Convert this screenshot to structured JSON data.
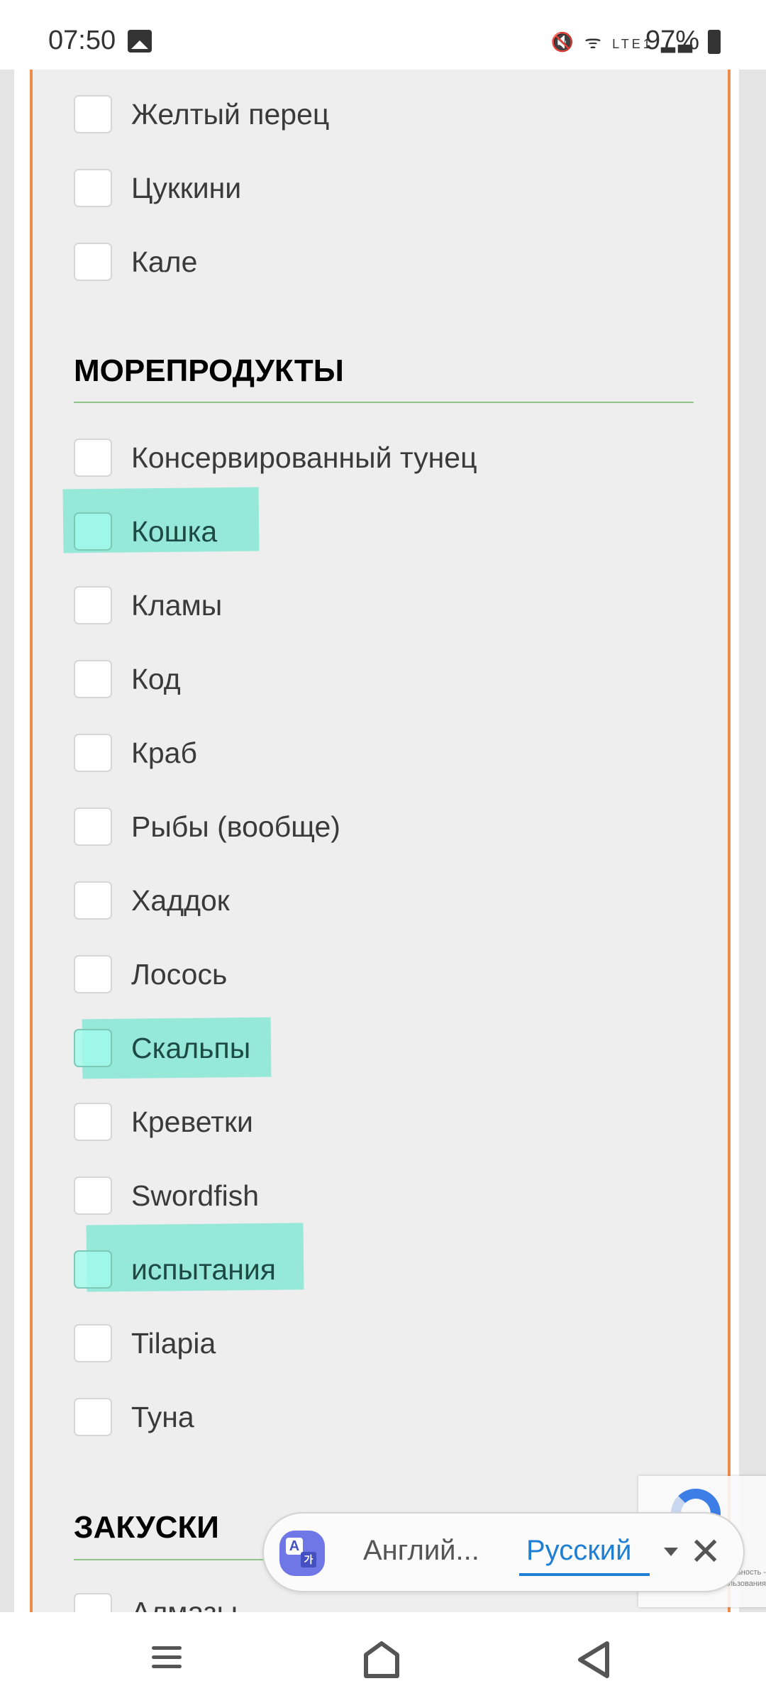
{
  "status_bar": {
    "time": "07:50",
    "battery": "97%",
    "network": "LTE1",
    "icons": [
      "gallery-icon",
      "mute-icon",
      "wifi-icon",
      "volte-icon",
      "signal-icon",
      "battery-icon"
    ]
  },
  "list": {
    "top_items": [
      "Желтый перец",
      "Цуккини",
      "Кале"
    ],
    "seafood_heading": "МОРЕПРОДУКТЫ",
    "seafood_items": [
      "Консервированный тунец",
      "Кошка",
      "Кламы",
      "Код",
      "Краб",
      "Рыбы (вообще)",
      "Хаддок",
      "Лосось",
      "Скальпы",
      "Креветки",
      "Swordfish",
      "испытания",
      "Tilapia",
      "Туна"
    ],
    "highlighted": [
      "Кошка",
      "Скальпы",
      "испытания"
    ],
    "snacks_heading": "ЗАКУСКИ",
    "snacks_items": [
      "Алмазы"
    ]
  },
  "translate_bar": {
    "source": "Англий...",
    "target": "Русский"
  },
  "recaptcha": {
    "privacy": "Конфиденциальность -",
    "terms": "Условия использования"
  },
  "colors": {
    "accent_border": "#ee8a4a",
    "highlight": "#78e6d2",
    "target_lang": "#1e7fd4",
    "heading_rule": "#8fc48b"
  }
}
